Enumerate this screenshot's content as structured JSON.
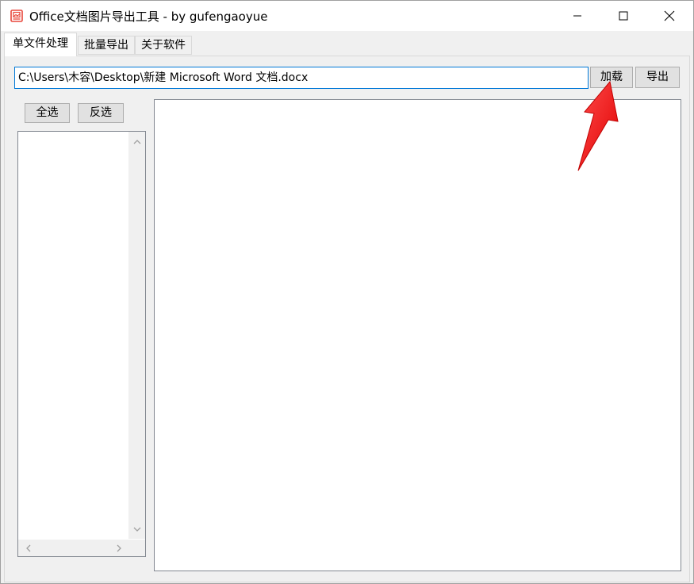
{
  "window": {
    "title": "Office文档图片导出工具 - by gufengaoyue"
  },
  "tabs": [
    {
      "label": "单文件处理",
      "active": true
    },
    {
      "label": "批量导出",
      "active": false
    },
    {
      "label": "关于软件",
      "active": false
    }
  ],
  "toolbar": {
    "path_value": "C:\\Users\\木容\\Desktop\\新建 Microsoft Word 文档.docx",
    "load_label": "加载",
    "export_label": "导出"
  },
  "list_controls": {
    "select_all_label": "全选",
    "invert_label": "反选"
  },
  "icons": {
    "app": "image-icon",
    "minimize": "minimize-icon",
    "maximize": "maximize-icon",
    "close": "close-icon",
    "scroll_up": "chevron-up-icon",
    "scroll_down": "chevron-down-icon",
    "scroll_left": "chevron-left-icon",
    "scroll_right": "chevron-right-icon"
  },
  "colors": {
    "accent": "#0078d7",
    "annotation": "#ff1a1a",
    "app_icon": "#e8473b"
  }
}
